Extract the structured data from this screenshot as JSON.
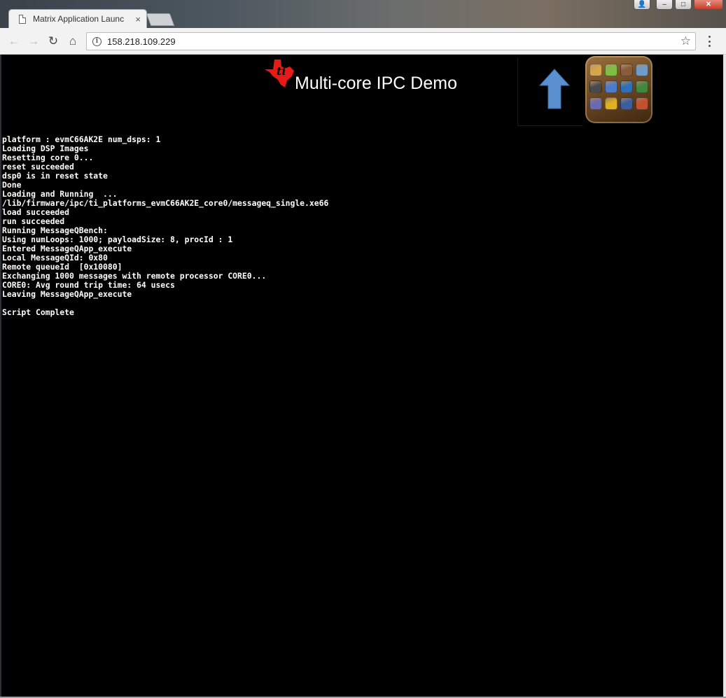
{
  "tab": {
    "title": "Matrix Application Launc",
    "close": "×"
  },
  "toolbar": {
    "back": "←",
    "forward": "→",
    "reload": "↻",
    "home": "⌂",
    "url": "158.218.109.229",
    "info": "i",
    "star": "☆"
  },
  "window": {
    "user": "👤",
    "minimize": "–",
    "maximize": "□",
    "close": "✕"
  },
  "page": {
    "title": "Multi-core IPC Demo",
    "logo_icon": "texas-instruments-logo",
    "back_icon": "up-arrow-icon",
    "launcher_icon": "app-launcher-icon",
    "console_lines": [
      "platform : evmC66AK2E num_dsps: 1",
      "Loading DSP Images",
      "Resetting core 0...",
      "reset succeeded",
      "dsp0 is in reset state",
      "Done",
      "Loading and Running  ...",
      "/lib/firmware/ipc/ti_platforms_evmC66AK2E_core0/messageq_single.xe66",
      "load succeeded",
      "run succeeded",
      "Running MessageQBench:",
      "Using numLoops: 1000; payloadSize: 8, procId : 1",
      "Entered MessageQApp_execute",
      "Local MessageQId: 0x80",
      "Remote queueId  [0x10080]",
      "Exchanging 1000 messages with remote processor CORE0...",
      "CORE0: Avg round trip time: 64 usecs",
      "Leaving MessageQApp_execute",
      "",
      "Script Complete"
    ]
  },
  "colors": {
    "console_bg": "#000000",
    "console_text": "#ffffff",
    "ti_red": "#e41b17",
    "arrow_blue": "#5a8fd0"
  },
  "launcher_apps": [
    "#d7a54a",
    "#7fbf3f",
    "#8a5a3a",
    "#6e9ccd",
    "#4a4a4a",
    "#4b7bd1",
    "#2f6fb8",
    "#3d8a3d",
    "#6a6ab0",
    "#e0b020",
    "#3a5fa0",
    "#c4502c"
  ]
}
